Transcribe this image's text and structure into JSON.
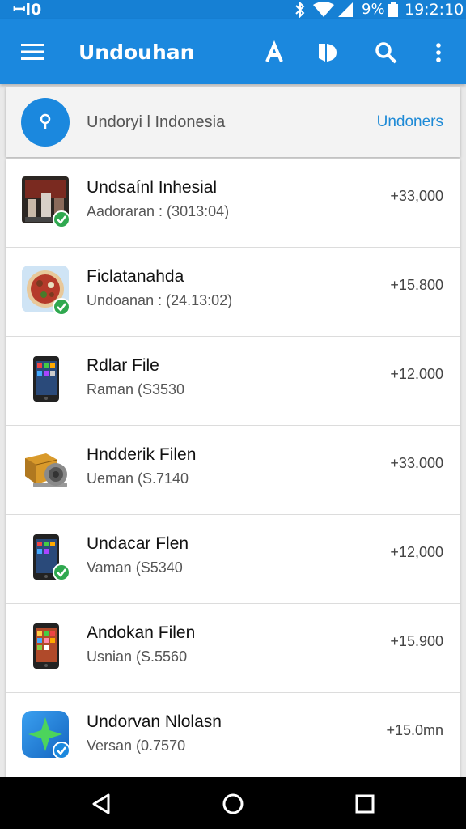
{
  "status_bar": {
    "left_indicator": "ꟷl0",
    "battery_percent": "9%",
    "time": "19:2:10",
    "icons": [
      "bluetooth-icon",
      "wifi-icon",
      "signal-icon",
      "battery-icon"
    ]
  },
  "app_bar": {
    "title": "Undouhan",
    "icons": [
      "menu-icon",
      "font-icon",
      "bookmark-icon",
      "search-icon",
      "more-vert-icon"
    ]
  },
  "header": {
    "text": "Undoryi l Indonesia",
    "link": "Undoners"
  },
  "items": [
    {
      "name": "Undsaínl Inhesial",
      "detail": "Aadoraran : (3013:04)",
      "size": "+33,000",
      "icon": "video-thumbnail-icon",
      "checked": true
    },
    {
      "name": "Ficlatanahda",
      "detail": "Undoanan : (24.13:02)",
      "size": "+15.800",
      "icon": "pizza-icon",
      "checked": true
    },
    {
      "name": "Rdlar File",
      "detail": "Raman (S3530",
      "size": "+12.000",
      "icon": "phone-icon",
      "checked": false
    },
    {
      "name": "Hndderik Filen",
      "detail": "Ueman (S.7140",
      "size": "+33.000",
      "icon": "box-speaker-icon",
      "checked": false
    },
    {
      "name": "Undacar Flen",
      "detail": "Vaman (S5340",
      "size": "+12,000",
      "icon": "phone-icon",
      "checked": true
    },
    {
      "name": "Andokan Filen",
      "detail": "Usnian (S.5560",
      "size": "+15.900",
      "icon": "phone-icon",
      "checked": false
    },
    {
      "name": "Undorvan Nlolasn",
      "detail": "Versan (0.7570",
      "size": "+15.0mn",
      "icon": "green-star-app-icon",
      "checked": true
    }
  ],
  "colors": {
    "primary": "#1b88de",
    "status_bar": "#1680d4",
    "check_green": "#2fa84f"
  },
  "nav_bar": {
    "icons": [
      "back-icon",
      "home-icon",
      "recents-icon"
    ]
  }
}
